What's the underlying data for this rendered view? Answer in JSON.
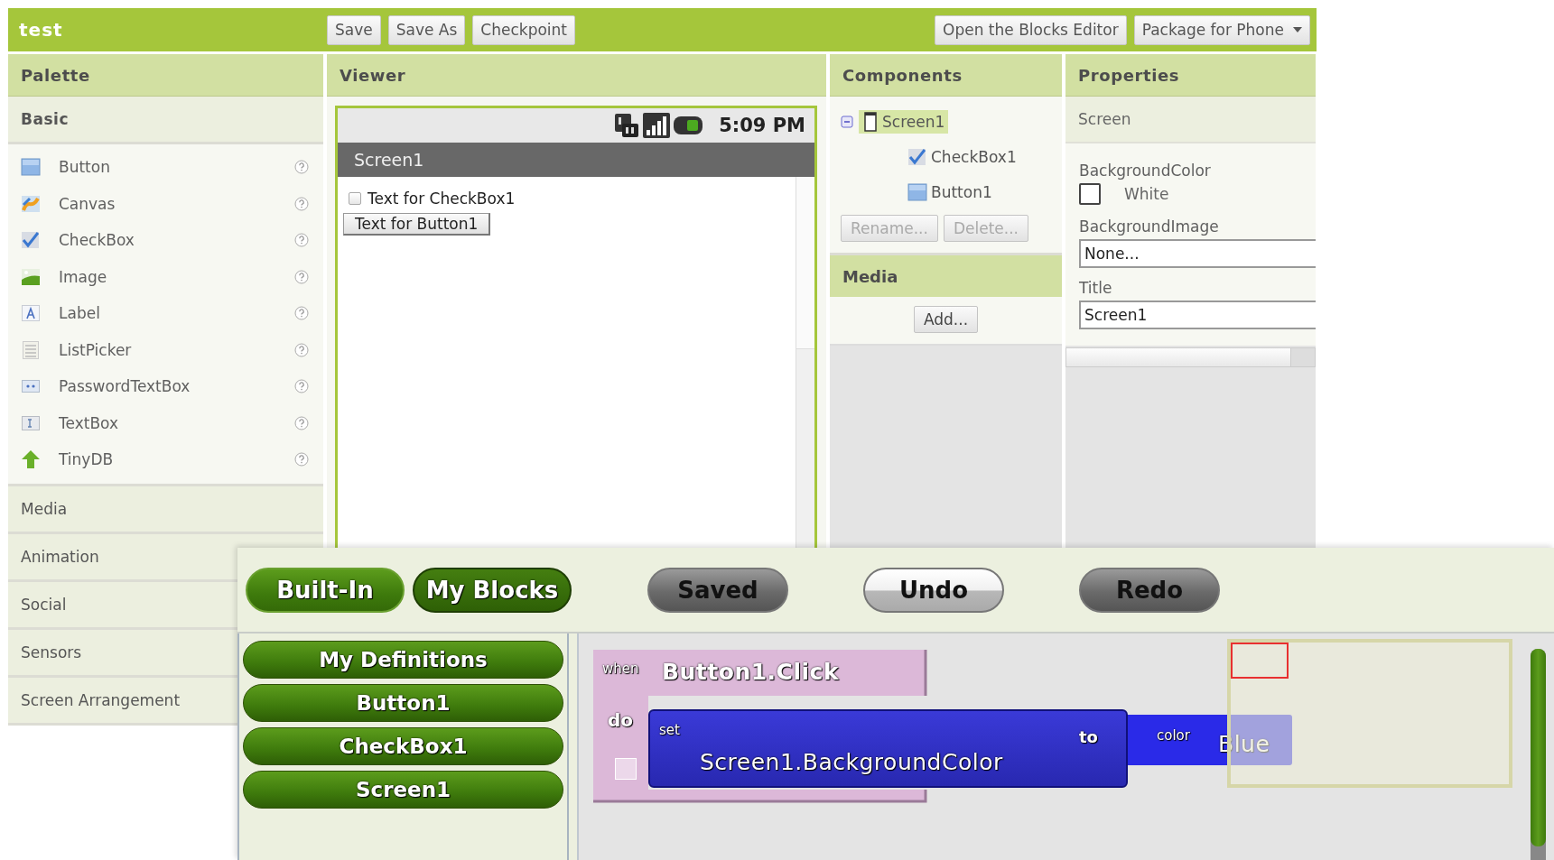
{
  "designer": {
    "project_title": "test",
    "toolbar_left": [
      {
        "label": "Save"
      },
      {
        "label": "Save As"
      },
      {
        "label": "Checkpoint"
      }
    ],
    "toolbar_right": [
      {
        "label": "Open the Blocks Editor",
        "has_menu": false
      },
      {
        "label": "Package for Phone",
        "has_menu": true
      }
    ],
    "palette": {
      "title": "Palette",
      "groups": [
        {
          "label": "Basic",
          "expanded": true,
          "items": [
            {
              "kind": "button",
              "label": "Button"
            },
            {
              "kind": "canvas",
              "label": "Canvas"
            },
            {
              "kind": "checkbox",
              "label": "CheckBox"
            },
            {
              "kind": "image",
              "label": "Image"
            },
            {
              "kind": "label",
              "label": "Label"
            },
            {
              "kind": "listpicker",
              "label": "ListPicker"
            },
            {
              "kind": "password",
              "label": "PasswordTextBox"
            },
            {
              "kind": "textbox",
              "label": "TextBox"
            },
            {
              "kind": "tinydb",
              "label": "TinyDB"
            }
          ]
        },
        {
          "label": "Media",
          "expanded": false
        },
        {
          "label": "Animation",
          "expanded": false
        },
        {
          "label": "Social",
          "expanded": false
        },
        {
          "label": "Sensors",
          "expanded": false
        },
        {
          "label": "Screen Arrangement",
          "expanded": false
        }
      ]
    },
    "viewer": {
      "title": "Viewer",
      "time": "5:09 PM",
      "screen_title": "Screen1",
      "components": [
        {
          "kind": "checkbox",
          "label": "Text for CheckBox1",
          "checked": false
        },
        {
          "kind": "button",
          "label": "Text for Button1"
        }
      ]
    },
    "components": {
      "title": "Components",
      "tree": [
        {
          "kind": "screen",
          "label": "Screen1",
          "selected": true,
          "expanded": true,
          "children": [
            {
              "kind": "checkbox",
              "label": "CheckBox1",
              "selected": false
            },
            {
              "kind": "button",
              "label": "Button1",
              "selected": false
            }
          ]
        }
      ],
      "buttons": [
        {
          "label": "Rename...",
          "disabled": true
        },
        {
          "label": "Delete...",
          "disabled": true
        }
      ]
    },
    "media": {
      "title": "Media",
      "button": "Add..."
    },
    "properties": {
      "title": "Properties",
      "component": "Screen",
      "fields": [
        {
          "kind": "color",
          "label": "BackgroundColor",
          "value": "White",
          "color": "#ffffff"
        },
        {
          "kind": "text",
          "label": "BackgroundImage",
          "value": "None..."
        },
        {
          "kind": "text",
          "label": "Title",
          "value": "Screen1"
        }
      ]
    }
  },
  "blocks_editor": {
    "tabs": [
      {
        "label": "Built-In",
        "selected": false
      },
      {
        "label": "My Blocks",
        "selected": true
      }
    ],
    "actions": [
      {
        "label": "Saved",
        "disabled": true
      },
      {
        "label": "Undo",
        "disabled": false
      },
      {
        "label": "Redo",
        "disabled": true
      }
    ],
    "drawers": [
      "My Definitions",
      "Button1",
      "CheckBox1",
      "Screen1"
    ],
    "event_block": {
      "keyword": "when",
      "event": "Button1.Click",
      "do_label": "do"
    },
    "set_block": {
      "keyword": "set",
      "property": "Screen1.BackgroundColor",
      "to_label": "to"
    },
    "color_block": {
      "keyword": "color",
      "value": "Blue"
    }
  }
}
